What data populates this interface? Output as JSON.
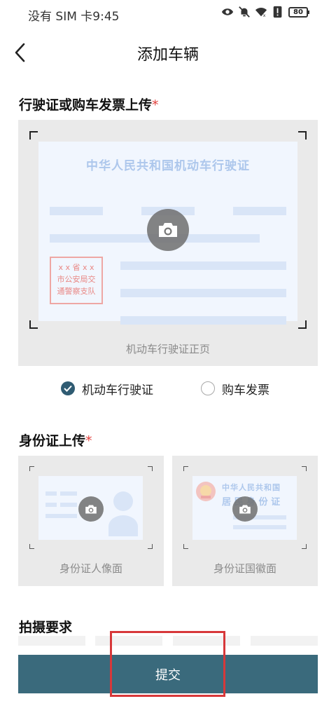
{
  "status_bar": {
    "carrier_time": "没有 SIM 卡9:45",
    "battery": "80"
  },
  "nav": {
    "title": "添加车辆"
  },
  "license_section": {
    "title": "行驶证或购车发票上传",
    "required_mark": "*",
    "card_title": "中华人民共和国机动车行驶证",
    "stamp_lines": [
      "x x 省 x x",
      "市公安局交",
      "通警察支队"
    ],
    "caption": "机动车行驶证正页",
    "options": [
      {
        "label": "机动车行驶证",
        "checked": true
      },
      {
        "label": "购车发票",
        "checked": false
      }
    ]
  },
  "id_section": {
    "title": "身份证上传",
    "required_mark": "*",
    "portrait_caption": "身份证人像面",
    "emblem_caption": "身份证国徽面",
    "emblem_card_line1": "中华人民共和国",
    "emblem_card_line2": "居 民 身 份 证"
  },
  "requirements": {
    "title": "拍摄要求"
  },
  "submit": {
    "label": "提交"
  },
  "colors": {
    "accent": "#3a6a7c",
    "checked_radio": "#2f5b72",
    "required": "#e2423f",
    "highlight": "#d7383a"
  }
}
